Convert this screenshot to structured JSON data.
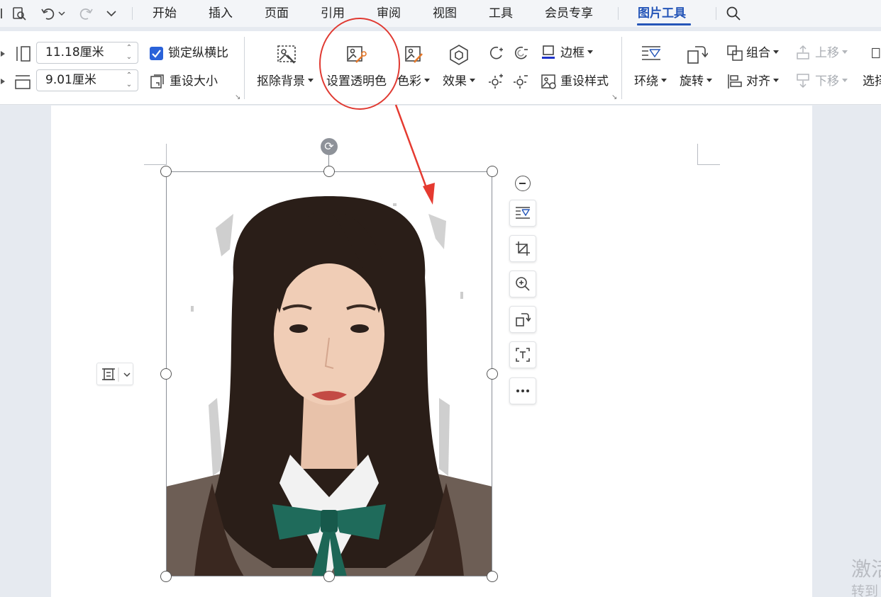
{
  "tabs": [
    "开始",
    "插入",
    "页面",
    "引用",
    "审阅",
    "视图",
    "工具",
    "会员专享",
    "图片工具"
  ],
  "active_tab": "图片工具",
  "quick_access": {
    "icons": [
      "print-preview-icon",
      "undo-icon",
      "redo-icon",
      "more-icon"
    ]
  },
  "size": {
    "width_value": "11.18厘米",
    "height_value": "9.01厘米",
    "lock_ratio_label": "锁定纵横比",
    "lock_ratio_checked": true,
    "reset_size_label": "重设大小"
  },
  "ribbon": {
    "remove_bg_label": "抠除背景",
    "set_transparent_label": "设置透明色",
    "color_label": "色彩",
    "effects_label": "效果",
    "border_label": "边框",
    "reset_style_label": "重设样式",
    "wrap_label": "环绕",
    "rotate_label": "旋转",
    "group_label": "组合",
    "align_label": "对齐",
    "bring_forward_label": "上移",
    "send_backward_label": "下移",
    "select_label": "选择"
  },
  "floating_toolbar": [
    "zoom-out-icon",
    "wrap-text-icon",
    "crop-icon",
    "zoom-in-icon",
    "rotate-icon",
    "ocr-text-icon",
    "more-dots-icon"
  ],
  "watermark": {
    "line1": "激活",
    "line2": "转到"
  },
  "annotation": {
    "highlight_color": "#e03a32",
    "arrow_color": "#e53a30"
  },
  "colors": {
    "accent": "#2556b8",
    "checkbox": "#2a62d9"
  }
}
